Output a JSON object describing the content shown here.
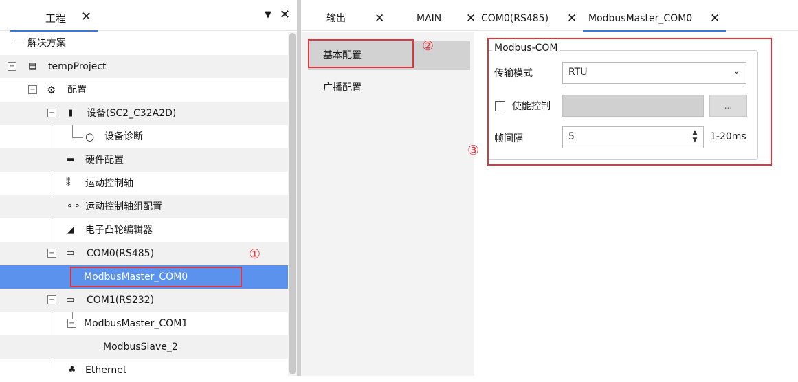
{
  "left_panel": {
    "tab_label": "工程",
    "tab_close": "✕",
    "menu_arrow": "▼",
    "panel_close": "✕",
    "tree": {
      "solution": "解决方案",
      "project": "tempProject",
      "config": "配置",
      "device": "设备(SC2_C32A2D)",
      "diagnosis": "设备诊断",
      "hardware": "硬件配置",
      "motion_axis": "运动控制轴",
      "motion_group": "运动控制轴组配置",
      "cam_editor": "电子凸轮编辑器",
      "com0": "COM0(RS485)",
      "modbus_master_com0": "ModbusMaster_COM0",
      "com1": "COM1(RS232)",
      "modbus_master_com1": "ModbusMaster_COM1",
      "modbus_slave_2": "ModbusSlave_2",
      "ethernet": "Ethernet"
    }
  },
  "tabs": [
    {
      "label": "输出"
    },
    {
      "label": "MAIN"
    },
    {
      "label": "COM0(RS485)"
    },
    {
      "label": "ModbusMaster_COM0"
    }
  ],
  "tab_close": "✕",
  "nav": {
    "basic_config": "基本配置",
    "broadcast_config": "广播配置"
  },
  "form": {
    "group_title": "Modbus-COM",
    "transfer_mode_label": "传输模式",
    "transfer_mode_value": "RTU",
    "enable_control_label": "使能控制",
    "browse_button": "...",
    "frame_interval_label": "帧间隔",
    "frame_interval_value": "5",
    "frame_interval_range": "1-20ms"
  },
  "annotations": {
    "one": "①",
    "two": "②",
    "three": "③"
  },
  "colors": {
    "selection": "#5b92ee",
    "annotation_red": "#e0353c",
    "tab_underline": "#3a78d6"
  }
}
